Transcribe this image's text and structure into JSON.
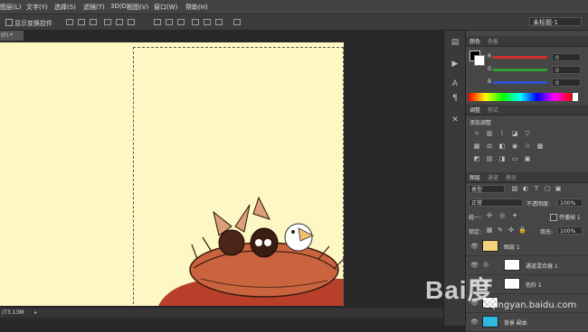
{
  "menu": {
    "items": [
      "图层(L)",
      "文字(Y)",
      "选择(S)",
      "滤镜(T)",
      "3D(D)",
      "视图(V)",
      "窗口(W)",
      "帮助(H)"
    ]
  },
  "options": {
    "show_transform_label": "显示变换控件",
    "workspace": "未标题-1"
  },
  "document": {
    "tab_label": "(F) *",
    "status_text": "/73.13M"
  },
  "color_panel": {
    "tabs": [
      "颜色",
      "色板"
    ],
    "channels": [
      {
        "name": "R",
        "value": "0"
      },
      {
        "name": "G",
        "value": "0"
      },
      {
        "name": "B",
        "value": "0"
      }
    ]
  },
  "adjust_panel": {
    "tabs": [
      "调整",
      "样式"
    ],
    "title": "添加调整"
  },
  "layers_panel": {
    "tabs": [
      "图层",
      "通道",
      "路径"
    ],
    "filter_kind": "类型",
    "blend_mode": "正常",
    "opacity_label": "不透明度:",
    "opacity_value": "100%",
    "unify_label": "统一:",
    "propagate_label": "传播帧 1",
    "lock_label": "锁定:",
    "fill_label": "填充:",
    "fill_value": "100%",
    "layers": [
      {
        "name": "图层 1",
        "visible": true
      },
      {
        "name": "通道混合器 1",
        "visible": true
      },
      {
        "name": "色阶 1",
        "visible": true
      },
      {
        "name": "",
        "visible": true
      },
      {
        "name": "背景 副本",
        "visible": true
      }
    ]
  },
  "watermark": {
    "logo": "Bai度经验",
    "url": "jingyan.baidu.com"
  },
  "colors": {
    "canvas_bg": "#fdf7c3",
    "nest": "#c9643f",
    "red_slider": "#d03030",
    "green_slider": "#30a030",
    "blue_slider": "#3050d0"
  }
}
